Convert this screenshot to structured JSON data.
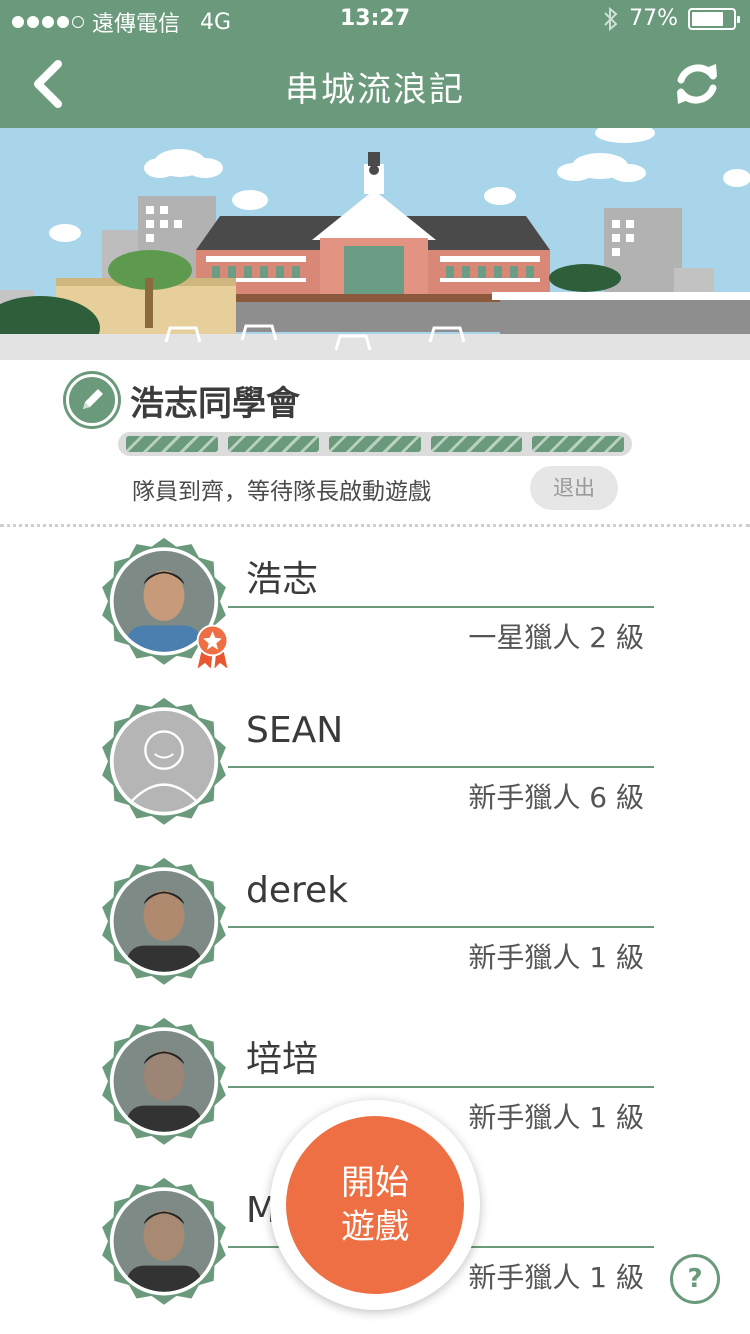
{
  "status_bar": {
    "carrier": "遠傳電信",
    "network": "4G",
    "time": "13:27",
    "battery": "77%",
    "battery_level": 0.77
  },
  "nav": {
    "title": "串城流浪記",
    "back_icon": "chevron-left-icon",
    "refresh_icon": "refresh-icon"
  },
  "team": {
    "name": "浩志同學會",
    "status": "隊員到齊，等待隊長啟動遊戲",
    "exit_label": "退出",
    "progress_segments": 5
  },
  "members": [
    {
      "name": "浩志",
      "rank": "一星獵人 2 級",
      "leader": true
    },
    {
      "name": "SEAN",
      "rank": "新手獵人 6 級",
      "leader": false
    },
    {
      "name": "derek",
      "rank": "新手獵人 1 級",
      "leader": false
    },
    {
      "name": "培培",
      "rank": "新手獵人 1 級",
      "leader": false
    },
    {
      "name": "M",
      "rank": "新手獵人 1 級",
      "leader": false
    }
  ],
  "start_button": {
    "line1": "開始",
    "line2": "遊戲"
  },
  "help_label": "?",
  "colors": {
    "primary": "#6a9a7b",
    "accent": "#ee6f43"
  }
}
